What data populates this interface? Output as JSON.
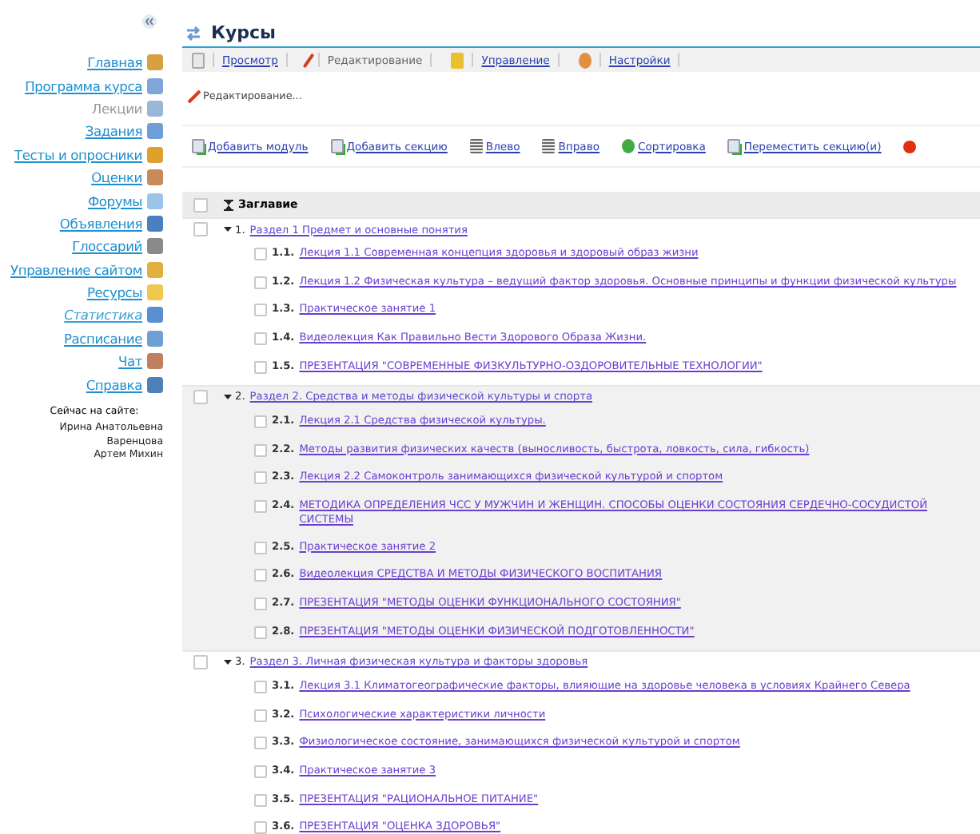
{
  "sidebar": {
    "items": [
      {
        "label": "Главная",
        "kind": "link"
      },
      {
        "label": "Программа курса",
        "kind": "link"
      },
      {
        "label": "Лекции",
        "kind": "inactive"
      },
      {
        "label": "Задания",
        "kind": "link"
      },
      {
        "label": "Тесты и опросники",
        "kind": "link"
      },
      {
        "label": "Оценки",
        "kind": "link"
      },
      {
        "label": "Форумы",
        "kind": "link"
      },
      {
        "label": "Объявления",
        "kind": "link"
      },
      {
        "label": "Глоссарий",
        "kind": "link"
      },
      {
        "label": "Управление сайтом",
        "kind": "link"
      },
      {
        "label": "Ресурсы",
        "kind": "link"
      },
      {
        "label": "Статистика",
        "kind": "italic"
      },
      {
        "label": "Расписание",
        "kind": "link"
      },
      {
        "label": "Чат",
        "kind": "link"
      },
      {
        "label": "Справка",
        "kind": "link"
      }
    ],
    "online_title": "Сейчас на сайте:",
    "online_users": [
      "Ирина Анатольевна Варенцова",
      "Артем Михин"
    ]
  },
  "title": "Курсы",
  "tabs": [
    {
      "label": "Просмотр",
      "selected": false
    },
    {
      "label": "Редактирование",
      "selected": true
    },
    {
      "label": "Управление",
      "selected": false
    },
    {
      "label": "Настройки",
      "selected": false
    }
  ],
  "mode_label": "Редактирование...",
  "actions": [
    "Добавить модуль",
    "Добавить секцию",
    "Влево",
    "Вправо",
    "Сортировка",
    "Переместить секцию(и)"
  ],
  "table": {
    "header": "Заглавие",
    "select_all_checked": false,
    "sections": [
      {
        "number": "1.",
        "title": "Раздел 1 Предмет и основные понятия",
        "expanded": true,
        "highlighted": false,
        "checked": false,
        "children": [
          {
            "number": "1.1.",
            "title": "Лекция 1.1 Современная концепция здоровья и здоровый образ жизни",
            "checked": false
          },
          {
            "number": "1.2.",
            "title": "Лекция 1.2 Физическая культура – ведущий фактор здоровья. Основные принципы и функции физической культуры",
            "checked": false
          },
          {
            "number": "1.3.",
            "title": "Практическое занятие 1",
            "checked": false
          },
          {
            "number": "1.4.",
            "title": "Видеолекция Как Правильно Вести Здорового Образа Жизни.",
            "checked": false
          },
          {
            "number": "1.5.",
            "title": "ПРЕЗЕНТАЦИЯ \"СОВРЕМЕННЫЕ ФИЗКУЛЬТУРНО-ОЗДОРОВИТЕЛЬНЫЕ ТЕХНОЛОГИИ\"",
            "checked": false
          }
        ]
      },
      {
        "number": "2.",
        "title": "Раздел 2. Средства и методы физической культуры и спорта",
        "expanded": true,
        "highlighted": true,
        "checked": false,
        "children": [
          {
            "number": "2.1.",
            "title": "Лекция 2.1 Средства физической культуры.",
            "checked": false
          },
          {
            "number": "2.2.",
            "title": "Методы развития физических качеств (выносливость, быстрота, ловкость, сила, гибкость)",
            "checked": false
          },
          {
            "number": "2.3.",
            "title": "Лекция 2.2 Самоконтроль занимающихся физической культурой и спортом",
            "checked": false
          },
          {
            "number": "2.4.",
            "title": "МЕТОДИКА ОПРЕДЕЛЕНИЯ ЧСС У МУЖЧИН И ЖЕНЩИН. СПОСОБЫ ОЦЕНКИ СОСТОЯНИЯ СЕРДЕЧНО-СОСУДИСТОЙ СИСТЕМЫ",
            "checked": false
          },
          {
            "number": "2.5.",
            "title": "Практическое занятие 2",
            "checked": false
          },
          {
            "number": "2.6.",
            "title": "Видеолекция СРЕДСТВА И МЕТОДЫ ФИЗИЧЕСКОГО ВОСПИТАНИЯ",
            "checked": false
          },
          {
            "number": "2.7.",
            "title": "ПРЕЗЕНТАЦИЯ \"МЕТОДЫ ОЦЕНКИ ФУНКЦИОНАЛЬНОГО СОСТОЯНИЯ\"",
            "checked": false
          },
          {
            "number": "2.8.",
            "title": "ПРЕЗЕНТАЦИЯ \"МЕТОДЫ ОЦЕНКИ ФИЗИЧЕСКОЙ ПОДГОТОВЛЕННОСТИ\"",
            "checked": false
          }
        ]
      },
      {
        "number": "3.",
        "title": "Раздел 3. Личная физическая культура и факторы здоровья",
        "expanded": true,
        "highlighted": false,
        "checked": false,
        "children": [
          {
            "number": "3.1.",
            "title": "Лекция 3.1 Климатогеографические факторы, влияющие на здоровье человека в условиях Крайнего Севера",
            "checked": false
          },
          {
            "number": "3.2.",
            "title": "Психологические характеристики личности",
            "checked": false
          },
          {
            "number": "3.3.",
            "title": "Физиологическое состояние, занимающихся физической культурой и спортом",
            "checked": false
          },
          {
            "number": "3.4.",
            "title": "Практическое занятие 3",
            "checked": false
          },
          {
            "number": "3.5.",
            "title": "ПРЕЗЕНТАЦИЯ \"РАЦИОНАЛЬНОЕ ПИТАНИЕ\"",
            "checked": false
          },
          {
            "number": "3.6.",
            "title": "ПРЕЗЕНТАЦИЯ \"ОЦЕНКА ЗДОРОВЬЯ\"",
            "checked": false
          }
        ]
      }
    ]
  }
}
